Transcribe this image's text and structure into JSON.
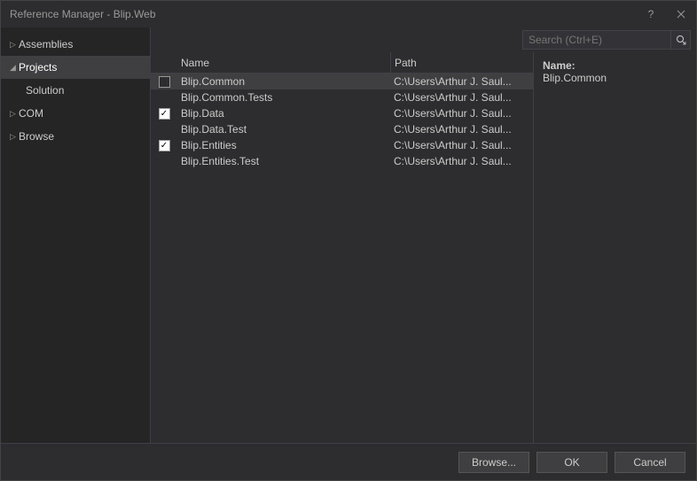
{
  "title": "Reference Manager - Blip.Web",
  "sidebar": {
    "items": [
      {
        "label": "Assemblies",
        "expanded": false,
        "selected": false
      },
      {
        "label": "Projects",
        "expanded": true,
        "selected": true,
        "children": [
          {
            "label": "Solution"
          }
        ]
      },
      {
        "label": "COM",
        "expanded": false,
        "selected": false
      },
      {
        "label": "Browse",
        "expanded": false,
        "selected": false
      }
    ]
  },
  "search": {
    "placeholder": "Search (Ctrl+E)"
  },
  "columns": {
    "name": "Name",
    "path": "Path"
  },
  "rows": [
    {
      "checked": false,
      "showCheck": true,
      "selected": true,
      "name": "Blip.Common",
      "path": "C:\\Users\\Arthur J. Saul..."
    },
    {
      "checked": false,
      "showCheck": false,
      "selected": false,
      "name": "Blip.Common.Tests",
      "path": "C:\\Users\\Arthur J. Saul..."
    },
    {
      "checked": true,
      "showCheck": true,
      "selected": false,
      "name": "Blip.Data",
      "path": "C:\\Users\\Arthur J. Saul..."
    },
    {
      "checked": false,
      "showCheck": false,
      "selected": false,
      "name": "Blip.Data.Test",
      "path": "C:\\Users\\Arthur J. Saul..."
    },
    {
      "checked": true,
      "showCheck": true,
      "selected": false,
      "name": "Blip.Entities",
      "path": "C:\\Users\\Arthur J. Saul..."
    },
    {
      "checked": false,
      "showCheck": false,
      "selected": false,
      "name": "Blip.Entities.Test",
      "path": "C:\\Users\\Arthur J. Saul..."
    }
  ],
  "detail": {
    "label": "Name:",
    "value": "Blip.Common"
  },
  "buttons": {
    "browse": "Browse...",
    "ok": "OK",
    "cancel": "Cancel"
  }
}
